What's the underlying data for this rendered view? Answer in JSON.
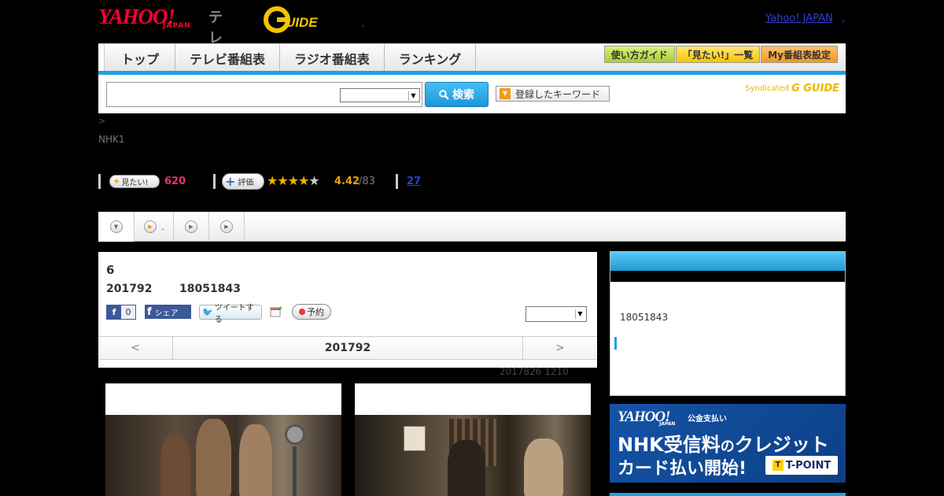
{
  "header": {
    "yahoo": "YAHOO!",
    "japan": "JAPAN",
    "terebi": "テレビ",
    "gguide": "G GUIDE",
    "yj_link": "Yahoo! JAPAN",
    "dot": ","
  },
  "nav": {
    "tabs": [
      "トップ",
      "テレビ番組表",
      "ラジオ番組表",
      "ランキング"
    ],
    "quick": [
      "使い方ガイド",
      "「見たい!」一覧",
      "My番組表設定"
    ]
  },
  "search": {
    "button": "検索",
    "keyword_button": "登録したキーワード",
    "syndicated": "Syndicated",
    "syndicated_logo": "G GUIDE"
  },
  "breadcrumb": ">",
  "channel": "NHK1",
  "stats": {
    "mitai_label": "見たい!",
    "mitai_count": "620",
    "hyoka_label": "評価",
    "rating": "4.42",
    "rating_count": "/83",
    "review_count": "27",
    "stars_filled": 4,
    "stars_total": 5
  },
  "subnav": {
    "item2_text": "."
  },
  "program": {
    "title": "6",
    "date": "201792",
    "time": "18051843",
    "fb_count": "0",
    "fb_share": "シェア",
    "tweet": "ツイートする",
    "reserve": "予約",
    "pager_prev": "<",
    "pager_mid": "201792",
    "pager_next": ">",
    "updated": "2017826  1210"
  },
  "sidebar": {
    "time": "18051843"
  },
  "ad": {
    "yahoo": "YAHOO!",
    "japan": "JAPAN",
    "kokin": "公金支払い",
    "line1_a": "NHK受信料",
    "line1_b": "の",
    "line1_c": "クレジット",
    "line2": "カード払い開始!",
    "tpoint": "T-POINT"
  },
  "colors": {
    "accent_blue": "#1fa0e6",
    "pink": "#e6336e",
    "star": "#f0b400"
  }
}
